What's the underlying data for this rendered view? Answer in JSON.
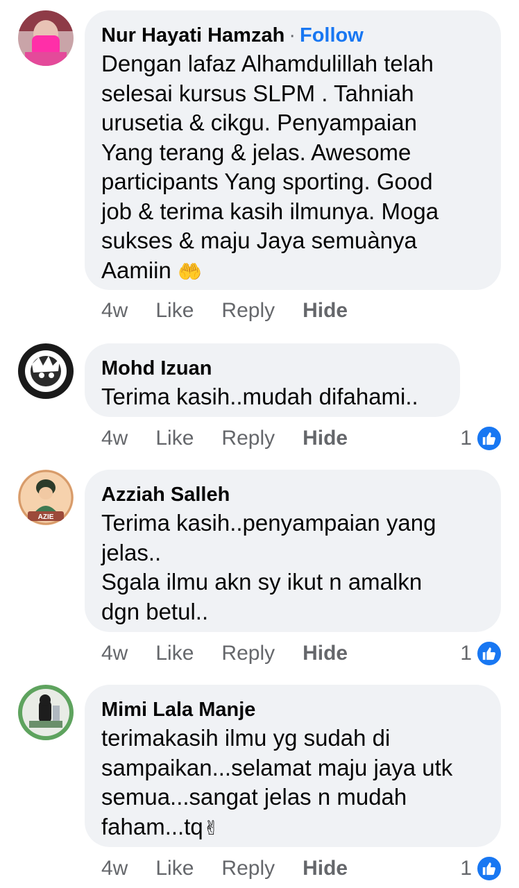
{
  "comments": [
    {
      "name": "Nur Hayati Hamzah",
      "follow": "Follow",
      "text": "Dengan lafaz Alhamdulillah telah\nselesai kursus SLPM . Tahniah\nurusetia & cikgu. Penyampaian\nYang terang & jelas. Awesome\nparticipants Yang sporting. Good\njob & terima kasih ilmunya. Moga\nsukses & maju Jaya semuànya\nAamiin",
      "emoji": "🤲",
      "time": "4w",
      "like": "Like",
      "reply": "Reply",
      "hide": "Hide",
      "reactions": ""
    },
    {
      "name": "Mohd Izuan",
      "text": "Terima kasih..mudah difahami..",
      "time": "4w",
      "like": "Like",
      "reply": "Reply",
      "hide": "Hide",
      "reactions": "1"
    },
    {
      "name": "Azziah Salleh",
      "avatar_label": "AZIE",
      "text": "Terima kasih..penyampaian yang\njelas..\nSgala ilmu akn sy ikut n amalkn\ndgn betul..",
      "time": "4w",
      "like": "Like",
      "reply": "Reply",
      "hide": "Hide",
      "reactions": "1"
    },
    {
      "name": "Mimi Lala Manje",
      "text": "terimakasih ilmu yg sudah di\nsampaikan...selamat maju jaya utk\nsemua...sangat jelas n mudah\nfaham...tq",
      "emoji": "✌",
      "time": "4w",
      "like": "Like",
      "reply": "Reply",
      "hide": "Hide",
      "reactions": "1"
    }
  ],
  "colors": {
    "bubble": "#f0f2f5",
    "accent": "#1877f2",
    "muted": "#65676b"
  }
}
